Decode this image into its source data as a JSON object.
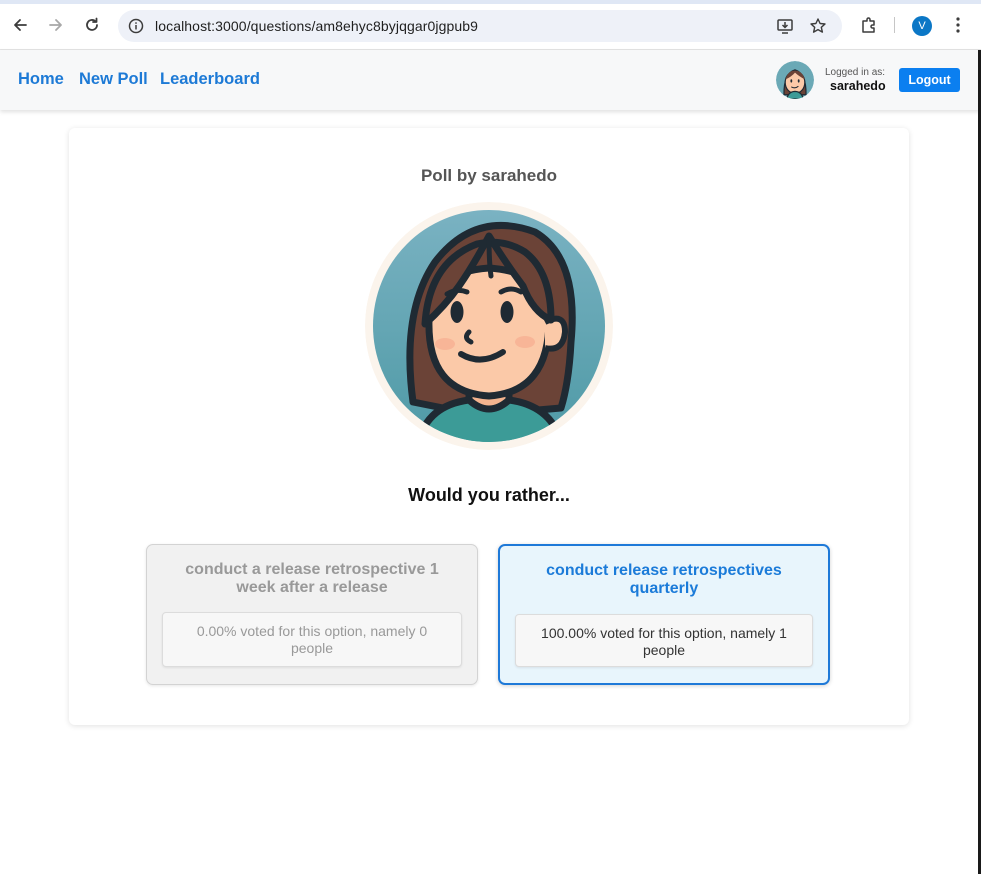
{
  "browser": {
    "url": "localhost:3000/questions/am8ehyc8byjqgar0jgpub9",
    "profile_initial": "V"
  },
  "nav": {
    "home": "Home",
    "new_poll": "New Poll",
    "leaderboard": "Leaderboard",
    "logged_in_label": "Logged in as:",
    "username": "sarahedo",
    "logout": "Logout"
  },
  "poll": {
    "title": "Poll by sarahedo",
    "question": "Would you rather...",
    "options": [
      {
        "text": "conduct a release retrospective 1 week after a release",
        "result": "0.00% voted for this option, namely 0 people",
        "percent": 0,
        "votes": 0,
        "selected": false
      },
      {
        "text": "conduct release retrospectives quarterly",
        "result": "100.00% voted for this option, namely 1 people",
        "percent": 100,
        "votes": 1,
        "selected": true
      }
    ]
  },
  "colors": {
    "link_blue": "#1d7ad6",
    "button_blue": "#0b7ff0",
    "selected_border": "#1e79d8",
    "selected_bg": "#e8f5fc"
  }
}
